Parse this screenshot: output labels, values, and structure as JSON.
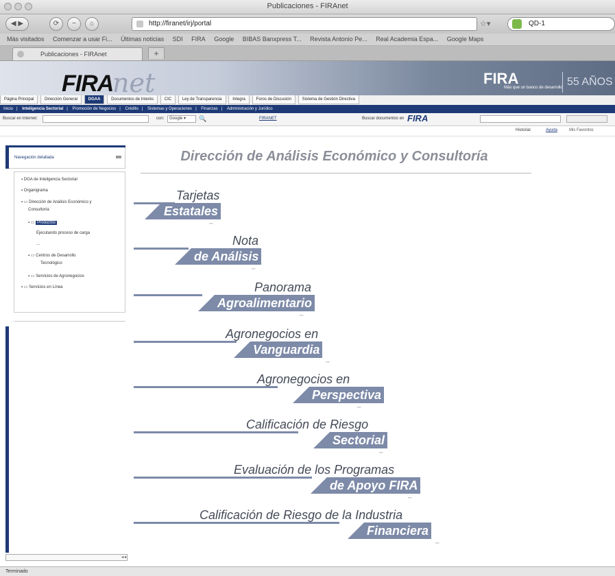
{
  "window": {
    "title": "Publicaciones - FIRAnet"
  },
  "navbar": {
    "url": "http://firanet/irj/portal",
    "search_value": "QD-1"
  },
  "bookmarks": [
    "Más visitados",
    "Comenzar a usar Fi...",
    "Últimas noticias",
    "SDI",
    "FIRA",
    "Google",
    "BIBAS Banxpress T...",
    "Revista Antonio Pe...",
    "Real Academia Espa...",
    "Google Maps"
  ],
  "tabs": [
    {
      "label": "Publicaciones - FIRAnet"
    }
  ],
  "banner": {
    "logo_main": "FIRA",
    "logo_script": "net",
    "logo_right": "FIRA",
    "logo_right_sub": "Más que un banco de desarrollo",
    "aniversario": "55 AÑOS"
  },
  "menu1": [
    "Página Principal",
    "Dirección General",
    "DGAA",
    "Documentos de Interés",
    "CIC",
    "Ley de Transparencia",
    "Integra",
    "Foros de Discusión",
    "Sistema de Gestión Directiva"
  ],
  "menu2": [
    "Inicio",
    "Inteligencia Sectorial",
    "Promoción de Negocios",
    "Crédito",
    "Sistemas y Operaciones",
    "Finanzas",
    "Administración y Jurídico"
  ],
  "searchrow": {
    "left_label": "Buscar en Internet:",
    "mid_label": "con:",
    "engine": "Google",
    "firanet_label": "FIRANET",
    "right_label": "Buscar documentos en"
  },
  "historyrow": {
    "historial": "Historial",
    "ayuda": "Ayuda",
    "user": "Mis Favoritos"
  },
  "sidebar": {
    "header": "Navegación detallada",
    "tree": [
      {
        "label": "DGA de Inteligencia Sectorial"
      },
      {
        "label": "Organigrama"
      },
      {
        "label": "Dirección de Análisis Económico y"
      },
      {
        "label": "Consultoría"
      },
      {
        "label": "Productos"
      },
      {
        "label": "Ejecutando proceso de carga"
      },
      {
        "label": "..."
      },
      {
        "label": "Centros de Desarrollo"
      },
      {
        "label": "Tecnológico"
      },
      {
        "label": "Servicios de Agronegocios"
      },
      {
        "label": "Servicios en Línea"
      }
    ]
  },
  "main": {
    "title": "Dirección de Análisis Económico y Consultoría",
    "items": [
      {
        "line1": "Tarjetas",
        "line2": "Estatales"
      },
      {
        "line1": "Nota",
        "line2": "de Análisis"
      },
      {
        "line1": "Panorama",
        "line2": "Agroalimentario"
      },
      {
        "line1": "Agronegocios en",
        "line2": "Vanguardia"
      },
      {
        "line1": "Agronegocios en",
        "line2": "Perspectiva"
      },
      {
        "line1": "Calificación de Riesgo",
        "line2": "Sectorial"
      },
      {
        "line1": "Evaluación de los Programas",
        "line2": "de Apoyo FIRA"
      },
      {
        "line1": "Calificación de Riesgo de la Industria",
        "line2": "Financiera"
      }
    ]
  },
  "status": {
    "text": "Terminado"
  },
  "colors": {
    "navy": "#1d3a77",
    "band": "#7d8aa8",
    "title_gray": "#8b8e98"
  }
}
